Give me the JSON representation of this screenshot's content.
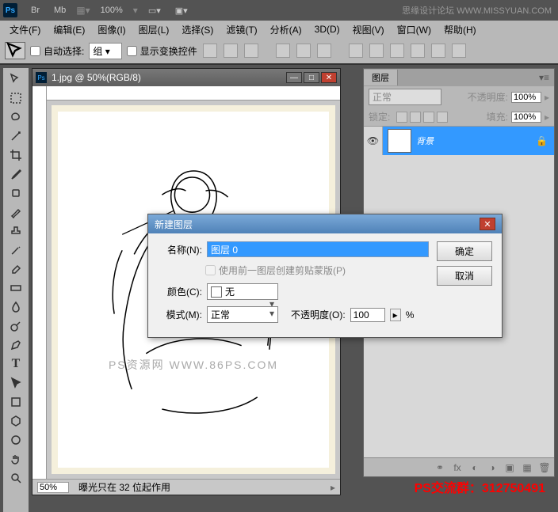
{
  "titlebar": {
    "br": "Br",
    "mb": "Mb",
    "zoom": "100%"
  },
  "watermark_top": "思缘设计论坛  WWW.MISSYUAN.COM",
  "menu": [
    "文件(F)",
    "编辑(E)",
    "图像(I)",
    "图层(L)",
    "选择(S)",
    "滤镜(T)",
    "分析(A)",
    "3D(D)",
    "视图(V)",
    "窗口(W)",
    "帮助(H)"
  ],
  "options": {
    "auto_select": "自动选择:",
    "group": "组",
    "show_transform": "显示变换控件"
  },
  "doc": {
    "title": "1.jpg @ 50%(RGB/8)",
    "zoom": "50%",
    "status": "曝光只在 32 位起作用",
    "art_wm": "PS资源网  WWW.86PS.COM"
  },
  "layers_panel": {
    "tab": "图层",
    "blend": "正常",
    "opacity_label": "不透明度:",
    "opacity": "100%",
    "lock_label": "锁定:",
    "fill_label": "填充:",
    "fill": "100%",
    "layer_name": "背景"
  },
  "dialog": {
    "title": "新建图层",
    "name_label": "名称(N):",
    "name_value": "图层 0",
    "clip_label": "使用前一图层创建剪贴蒙版(P)",
    "color_label": "颜色(C):",
    "color_value": "无",
    "mode_label": "模式(M):",
    "mode_value": "正常",
    "opacity_label": "不透明度(O):",
    "opacity_value": "100",
    "percent": "%",
    "ok": "确定",
    "cancel": "取消"
  },
  "promo": "PS交流群：312750491"
}
